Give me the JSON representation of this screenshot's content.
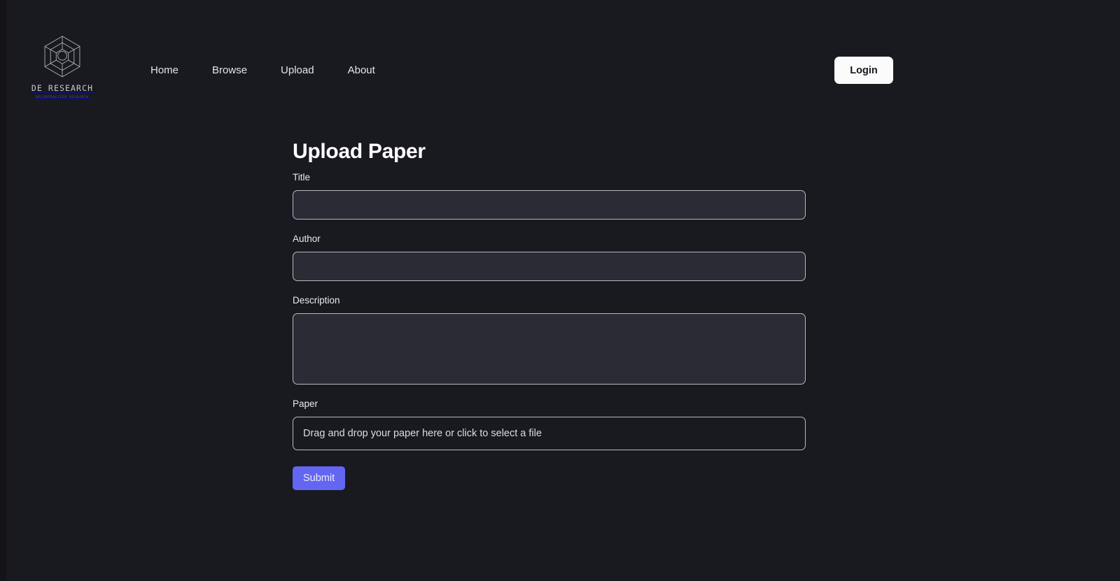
{
  "brand": {
    "name": "DE RESEARCH",
    "tagline": "DECENTRALIZED RESEARCH",
    "logo_icon": "hexagon-network-icon"
  },
  "nav": {
    "items": [
      {
        "label": "Home"
      },
      {
        "label": "Browse"
      },
      {
        "label": "Upload"
      },
      {
        "label": "About"
      }
    ]
  },
  "header": {
    "login_label": "Login"
  },
  "main": {
    "page_title": "Upload Paper",
    "fields": {
      "title": {
        "label": "Title",
        "value": "",
        "placeholder": ""
      },
      "author": {
        "label": "Author",
        "value": "",
        "placeholder": ""
      },
      "description": {
        "label": "Description",
        "value": "",
        "placeholder": ""
      },
      "paper": {
        "label": "Paper",
        "dropzone_text": "Drag and drop your paper here or click to select a file"
      }
    },
    "submit_label": "Submit"
  },
  "colors": {
    "page_background": "#191920",
    "input_background": "#2b2b35",
    "input_border": "#b9b9c2",
    "accent": "#6366f1",
    "login_background": "#fbfbfb",
    "text_primary": "#e8e8ec"
  }
}
